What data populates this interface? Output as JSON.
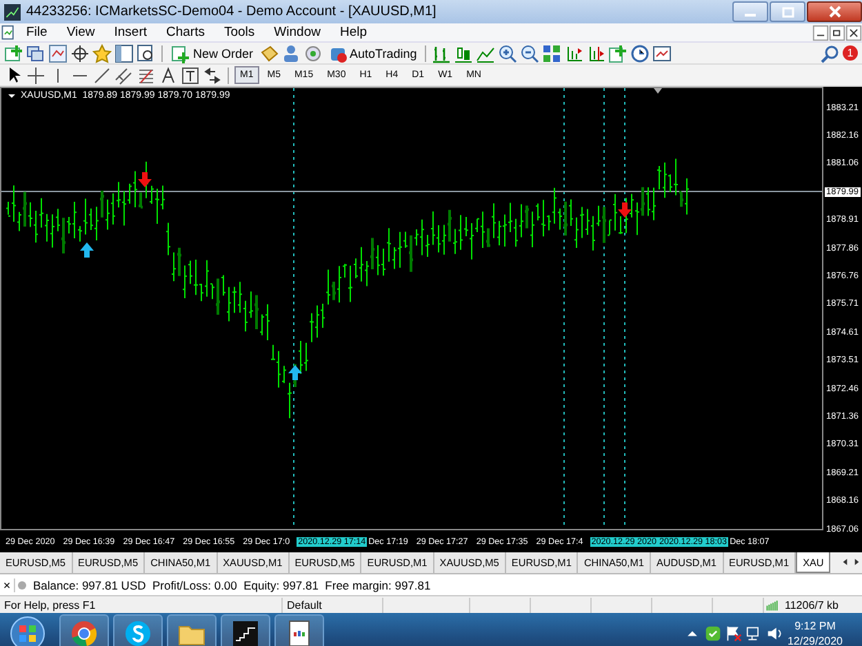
{
  "window": {
    "title": "44233256: ICMarketsSC-Demo04 - Demo Account - [XAUUSD,M1]"
  },
  "menu": [
    "File",
    "View",
    "Insert",
    "Charts",
    "Tools",
    "Window",
    "Help"
  ],
  "toolbar": {
    "new_order": "New Order",
    "auto_trading": "AutoTrading",
    "notifications": "1"
  },
  "timeframes": [
    {
      "label": "M1",
      "selected": true
    },
    {
      "label": "M5",
      "selected": false
    },
    {
      "label": "M15",
      "selected": false
    },
    {
      "label": "M30",
      "selected": false
    },
    {
      "label": "H1",
      "selected": false
    },
    {
      "label": "H4",
      "selected": false
    },
    {
      "label": "D1",
      "selected": false
    },
    {
      "label": "W1",
      "selected": false
    },
    {
      "label": "MN",
      "selected": false
    }
  ],
  "chart": {
    "header": "XAUUSD,M1  1879.89 1879.99 1879.70 1879.99",
    "price_labels": [
      {
        "text": "1883.21",
        "current": false
      },
      {
        "text": "1882.16",
        "current": false
      },
      {
        "text": "1881.06",
        "current": false
      },
      {
        "text": "1879.99",
        "current": true
      },
      {
        "text": "1878.91",
        "current": false
      },
      {
        "text": "1877.86",
        "current": false
      },
      {
        "text": "1876.76",
        "current": false
      },
      {
        "text": "1875.71",
        "current": false
      },
      {
        "text": "1874.61",
        "current": false
      },
      {
        "text": "1873.51",
        "current": false
      },
      {
        "text": "1872.46",
        "current": false
      },
      {
        "text": "1871.36",
        "current": false
      },
      {
        "text": "1870.31",
        "current": false
      },
      {
        "text": "1869.21",
        "current": false
      },
      {
        "text": "1868.16",
        "current": false
      },
      {
        "text": "1867.06",
        "current": false
      }
    ],
    "time_labels": [
      {
        "text": "29 Dec 2020",
        "highlighted": false
      },
      {
        "text": "29 Dec 16:39",
        "highlighted": false
      },
      {
        "text": "29 Dec 16:47",
        "highlighted": false
      },
      {
        "text": "29 Dec 16:55",
        "highlighted": false
      },
      {
        "text": "29 Dec 17:0",
        "highlighted": false
      },
      {
        "text": "2020.12.29 17:14",
        "highlighted": true
      },
      {
        "text": "Dec 17:19",
        "highlighted": false
      },
      {
        "text": "29 Dec 17:27",
        "highlighted": false
      },
      {
        "text": "29 Dec 17:35",
        "highlighted": false
      },
      {
        "text": "29 Dec 17:4",
        "highlighted": false
      },
      {
        "text": "2020.12.29 2020",
        "highlighted": true
      },
      {
        "text": "2020.12.29 18:03",
        "highlighted": true
      },
      {
        "text": "Dec 18:07",
        "highlighted": false
      }
    ]
  },
  "chart_tabs": [
    {
      "label": "EURUSD,M5",
      "selected": false
    },
    {
      "label": "EURUSD,M5",
      "selected": false
    },
    {
      "label": "CHINA50,M1",
      "selected": false
    },
    {
      "label": "XAUUSD,M1",
      "selected": false
    },
    {
      "label": "EURUSD,M5",
      "selected": false
    },
    {
      "label": "EURUSD,M1",
      "selected": false
    },
    {
      "label": "XAUUSD,M5",
      "selected": false
    },
    {
      "label": "EURUSD,M1",
      "selected": false
    },
    {
      "label": "CHINA50,M1",
      "selected": false
    },
    {
      "label": "AUDUSD,M1",
      "selected": false
    },
    {
      "label": "EURUSD,M1",
      "selected": false
    },
    {
      "label": "XAU",
      "selected": true
    }
  ],
  "terminal": {
    "close": "×",
    "balance": "Balance: 997.81 USD  Profit/Loss: 0.00  Equity: 997.81  Free margin: 997.81"
  },
  "status_bar": {
    "help": "For Help, press F1",
    "profile": "Default",
    "traffic": "11206/7 kb"
  },
  "taskbar": {
    "time": "9:12 PM",
    "date": "12/29/2020"
  }
}
